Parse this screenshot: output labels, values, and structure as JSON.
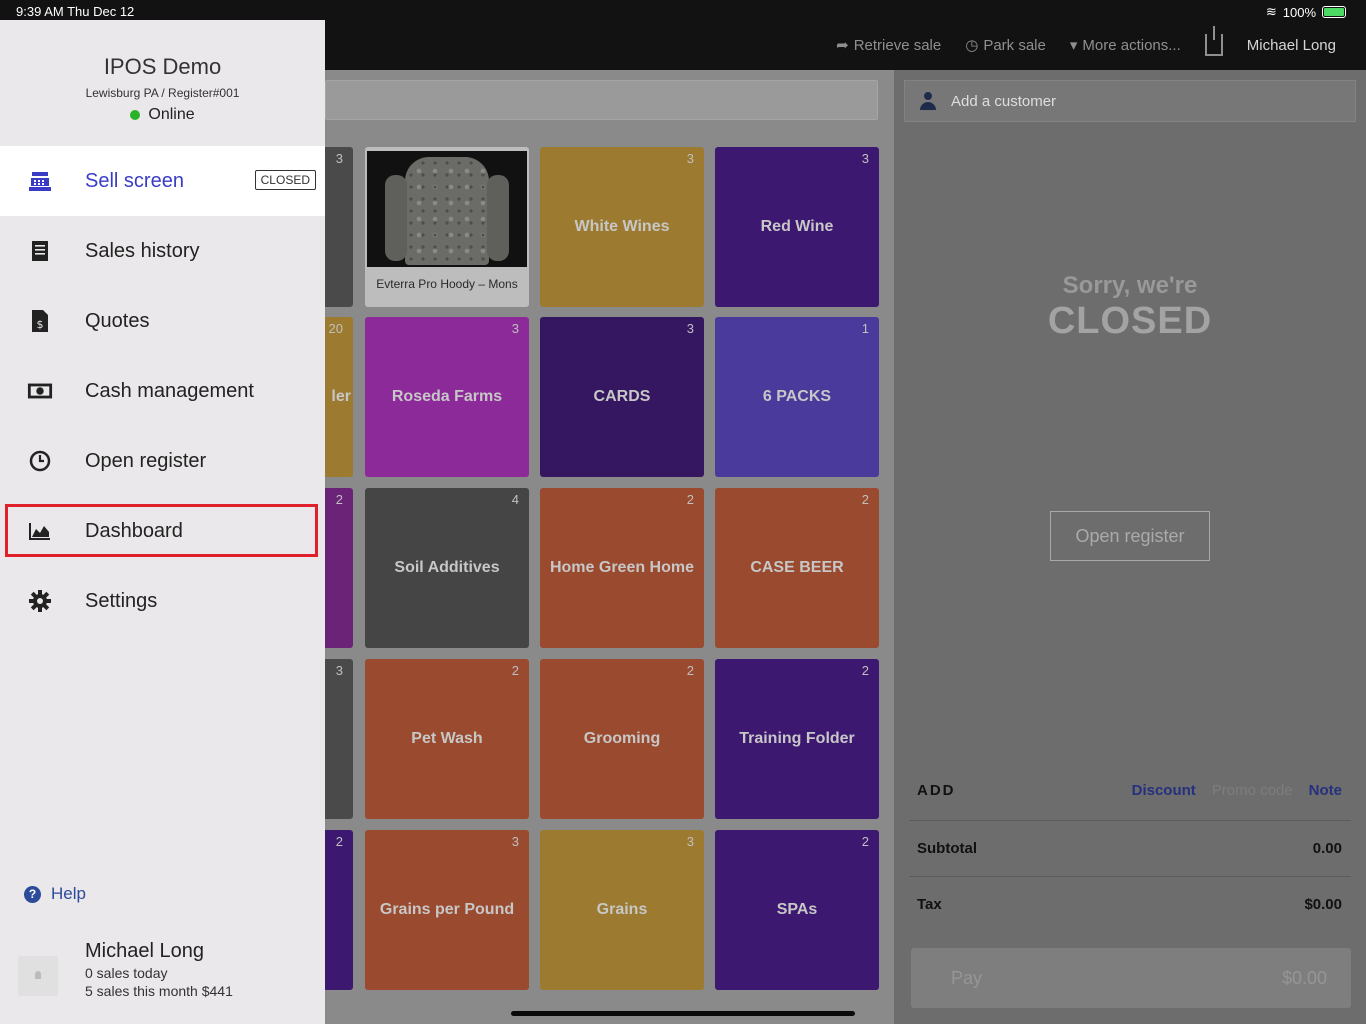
{
  "status_bar": {
    "time": "9:39 AM   Thu Dec 12",
    "battery": "100%"
  },
  "toolbar": {
    "retrieve_sale": "Retrieve sale",
    "park_sale": "Park sale",
    "more_actions": "More actions...",
    "user": "Michael Long"
  },
  "sidebar": {
    "store_name": "IPOS Demo",
    "store_location": "Lewisburg PA / Register#001",
    "status": "Online",
    "items": [
      {
        "label": "Sell screen",
        "badge": "CLOSED",
        "icon": "register-icon"
      },
      {
        "label": "Sales history",
        "icon": "receipt-icon"
      },
      {
        "label": "Quotes",
        "icon": "quote-document-icon"
      },
      {
        "label": "Cash management",
        "icon": "cash-icon"
      },
      {
        "label": "Open register",
        "icon": "clock-icon"
      },
      {
        "label": "Dashboard",
        "icon": "area-chart-icon"
      },
      {
        "label": "Settings",
        "icon": "gear-icon"
      }
    ],
    "help": "Help",
    "user": {
      "name": "Michael Long",
      "sales_today": "0 sales today",
      "sales_month": "5 sales this month $441"
    }
  },
  "tiles": [
    {
      "label": "",
      "count": "3",
      "color": "#4a4a4a"
    },
    {
      "label": "Evterra Pro Hoody – Mons",
      "count": "",
      "color": "#bdbdbd",
      "image": true
    },
    {
      "label": "White Wines",
      "count": "3",
      "color": "#9c7a2f"
    },
    {
      "label": "Red Wine",
      "count": "3",
      "color": "#3d1870"
    },
    {
      "label": "ler",
      "count": "20",
      "color": "#9c7a2f"
    },
    {
      "label": "Roseda Farms",
      "count": "3",
      "color": "#8d2a9a"
    },
    {
      "label": "CARDS",
      "count": "3",
      "color": "#351660"
    },
    {
      "label": "6 PACKS",
      "count": "1",
      "color": "#4a3a9c"
    },
    {
      "label": "",
      "count": "2",
      "color": "#6a2376"
    },
    {
      "label": "Soil Additives",
      "count": "4",
      "color": "#454545"
    },
    {
      "label": "Home Green Home",
      "count": "2",
      "color": "#9a4a2e"
    },
    {
      "label": "CASE BEER",
      "count": "2",
      "color": "#9a4a2e"
    },
    {
      "label": "",
      "count": "3",
      "color": "#4a4a4a"
    },
    {
      "label": "Pet Wash",
      "count": "2",
      "color": "#9a4a2e"
    },
    {
      "label": "Grooming",
      "count": "2",
      "color": "#9a4a2e"
    },
    {
      "label": "Training Folder",
      "count": "2",
      "color": "#3d1870"
    },
    {
      "label": "",
      "count": "2",
      "color": "#3d1870"
    },
    {
      "label": "Grains per Pound",
      "count": "3",
      "color": "#9a4a2e"
    },
    {
      "label": "Grains",
      "count": "3",
      "color": "#9c7a2f"
    },
    {
      "label": "SPAs",
      "count": "2",
      "color": "#3d1870"
    }
  ],
  "sale_panel": {
    "add_customer": "Add a customer",
    "sorry": "Sorry, we're",
    "closed": "CLOSED",
    "open_register": "Open register",
    "add": "ADD",
    "discount": "Discount",
    "promo_code": "Promo code",
    "note": "Note",
    "subtotal_label": "Subtotal",
    "subtotal_value": "0.00",
    "tax_label": "Tax",
    "tax_value": "$0.00",
    "pay_label": "Pay",
    "pay_value": "$0.00"
  },
  "colors": {
    "accent": "#3b3cc6",
    "highlight": "#e0202a",
    "online": "#29b32b",
    "link": "#25307e"
  }
}
